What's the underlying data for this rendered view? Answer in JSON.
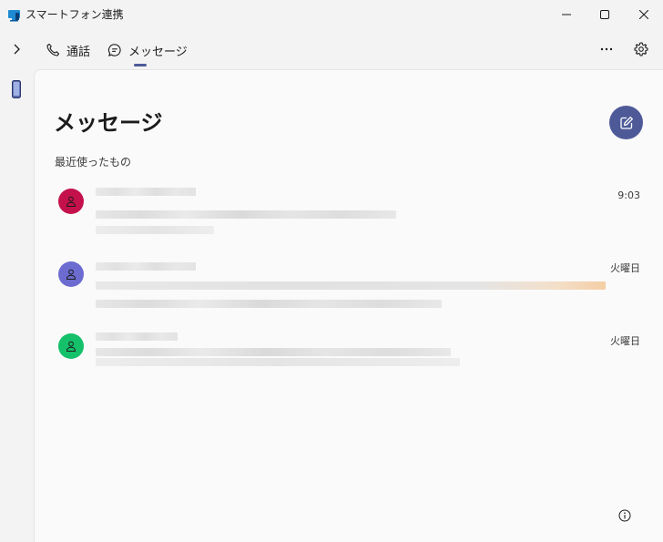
{
  "window": {
    "title": "スマートフォン連携"
  },
  "nav": {
    "tabs": [
      {
        "label": "通話",
        "icon": "phone-call-icon",
        "active": false
      },
      {
        "label": "メッセージ",
        "icon": "chat-bubble-icon",
        "active": true
      }
    ]
  },
  "main": {
    "title": "メッセージ",
    "section_label": "最近使ったもの",
    "conversations": [
      {
        "time": "9:03",
        "avatar_color": "#c4114c"
      },
      {
        "time": "火曜日",
        "avatar_color": "#6b6bd0"
      },
      {
        "time": "火曜日",
        "avatar_color": "#14c06a"
      }
    ]
  },
  "colors": {
    "accent": "#4e5a98",
    "panel_bg": "#fafafa",
    "window_bg": "#f3f3f3"
  }
}
